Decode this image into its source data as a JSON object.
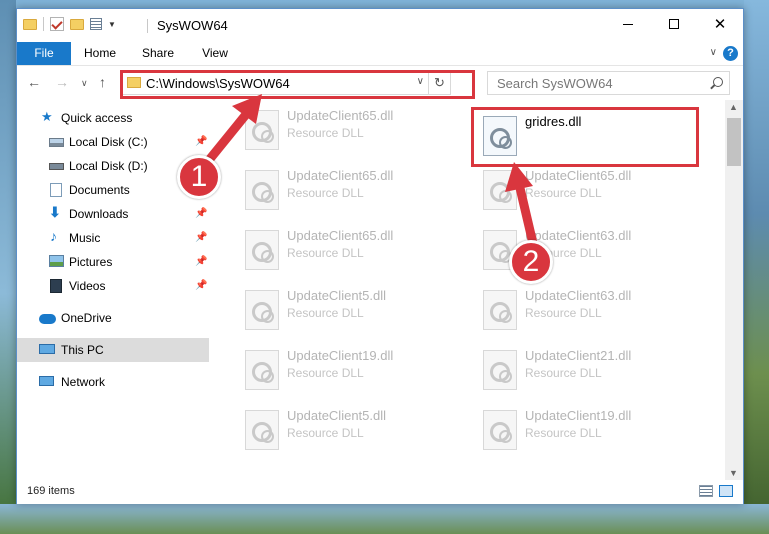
{
  "window": {
    "title": "SysWOW64"
  },
  "ribbon": {
    "tabs": [
      "File",
      "Home",
      "Share",
      "View"
    ]
  },
  "address": {
    "path": "C:\\Windows\\SysWOW64"
  },
  "search": {
    "placeholder": "Search SysWOW64"
  },
  "sidebar": {
    "items": [
      {
        "label": "Quick access",
        "icon": "star-icon"
      },
      {
        "label": "Local Disk (C:)",
        "icon": "drive-icon",
        "pinned": true
      },
      {
        "label": "Local Disk (D:)",
        "icon": "drive-icon"
      },
      {
        "label": "Documents",
        "icon": "documents-icon"
      },
      {
        "label": "Downloads",
        "icon": "download-icon",
        "pinned": true
      },
      {
        "label": "Music",
        "icon": "music-icon",
        "pinned": true
      },
      {
        "label": "Pictures",
        "icon": "pictures-icon",
        "pinned": true
      },
      {
        "label": "Videos",
        "icon": "videos-icon",
        "pinned": true
      },
      {
        "label": "OneDrive",
        "icon": "cloud-icon"
      },
      {
        "label": "This PC",
        "icon": "computer-icon",
        "selected": true
      },
      {
        "label": "Network",
        "icon": "network-icon"
      }
    ]
  },
  "files": [
    {
      "name": "UpdateClient65.dll",
      "type": "Resource DLL"
    },
    {
      "name": "gridres.dll",
      "type": "",
      "highlighted": true
    },
    {
      "name": "UpdateClient65.dll",
      "type": "Resource DLL"
    },
    {
      "name": "UpdateClient65.dll",
      "type": "Resource DLL"
    },
    {
      "name": "UpdateClient65.dll",
      "type": "Resource DLL"
    },
    {
      "name": "UpdateClient63.dll",
      "type": "Resource DLL"
    },
    {
      "name": "UpdateClient5.dll",
      "type": "Resource DLL"
    },
    {
      "name": "UpdateClient63.dll",
      "type": "Resource DLL"
    },
    {
      "name": "UpdateClient19.dll",
      "type": "Resource DLL"
    },
    {
      "name": "UpdateClient21.dll",
      "type": "Resource DLL"
    },
    {
      "name": "UpdateClient5.dll",
      "type": "Resource DLL"
    },
    {
      "name": "UpdateClient19.dll",
      "type": "Resource DLL"
    }
  ],
  "status": {
    "item_count": "169 items"
  },
  "annotations": {
    "step1": "1",
    "step2": "2",
    "color": "#d9363e"
  }
}
